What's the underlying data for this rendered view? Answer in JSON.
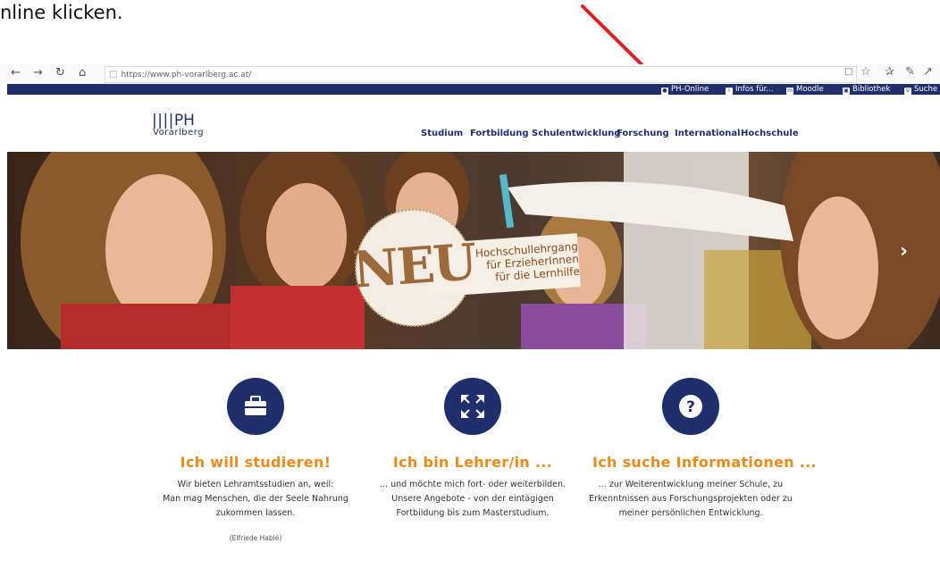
{
  "caption": "nline klicken.",
  "browser": {
    "url": "https://www.ph-vorarlberg.ac.at/",
    "nav_icons": [
      "back-icon",
      "forward-icon",
      "refresh-icon",
      "home-icon"
    ],
    "right_icons": [
      "reading-view-icon",
      "favorite-star-icon",
      "favorites-icon",
      "notes-icon",
      "share-icon",
      "more-icon"
    ]
  },
  "topbar": {
    "links": [
      {
        "label": "PH-Online",
        "icon": "ph-online-icon"
      },
      {
        "label": "Infos für...",
        "icon": "info-icon"
      },
      {
        "label": "Moodle",
        "icon": "moodle-icon"
      },
      {
        "label": "Bibliothek",
        "icon": "library-icon"
      },
      {
        "label": "Suche",
        "icon": "search-icon"
      }
    ]
  },
  "logo": {
    "bars": "||||",
    "ph": "PH",
    "sub": "Vorarlberg"
  },
  "nav": [
    "Studium",
    "Fortbildung",
    "Schulentwicklung",
    "Forschung",
    "International",
    "Hochschule"
  ],
  "hero": {
    "badge": "NEU",
    "banner": [
      "Hochschullehrgang",
      "für ErzieherInnen",
      "für die Lernhilfe"
    ]
  },
  "features": [
    {
      "icon": "briefcase-icon",
      "title": "Ich will studieren!",
      "lines": [
        "Wir bieten Lehramtsstudien an, weil:",
        "Man mag Menschen, die der Seele Nahrung",
        "zukommen lassen."
      ],
      "author": "(Elfriede Hablé)"
    },
    {
      "icon": "expand-arrows-icon",
      "title": "Ich bin Lehrer/in ...",
      "lines": [
        "... und möchte mich fort- oder weiterbilden.",
        "Unsere Angebote - von der eintägigen",
        "Fortbildung bis zum Masterstudium."
      ]
    },
    {
      "icon": "question-icon",
      "title": "Ich suche Informationen ...",
      "lines": [
        "... zur Weiterentwicklung meiner Schule, zu",
        "Erkenntnissen aus Forschungsprojekten oder zu",
        "meiner persönlichen Entwicklung."
      ]
    }
  ],
  "colors": {
    "brand_navy": "#1f2f6e",
    "accent_orange": "#ea8b1c",
    "arrow_red": "#e31e24"
  }
}
